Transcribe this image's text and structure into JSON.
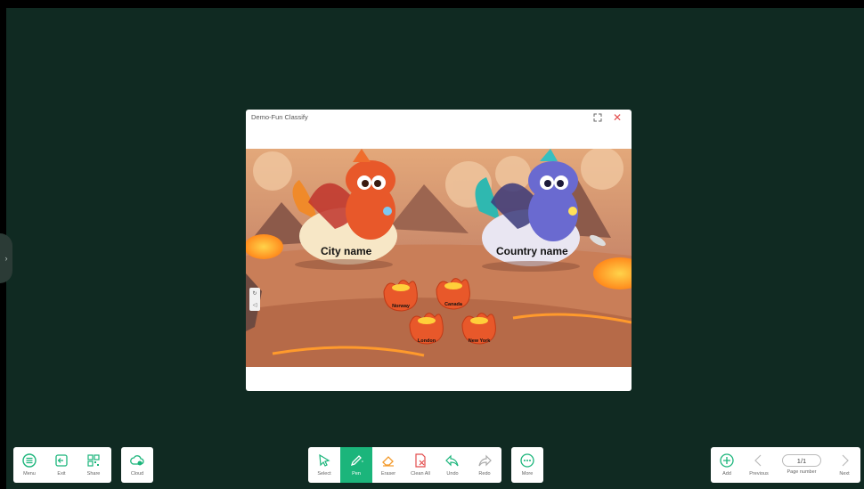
{
  "window": {
    "title": "Demo-Fun Classify",
    "labels": {
      "left_group": "City name",
      "right_group": "Country name"
    },
    "items": [
      "Norway",
      "Canada",
      "London",
      "New York"
    ]
  },
  "toolbar_left": {
    "menu": "Menu",
    "exit": "Exit",
    "share": "Share",
    "cloud": "Cloud"
  },
  "toolbar_center": {
    "select": "Select",
    "pen": "Pen",
    "eraser": "Eraser",
    "clean_all": "Clean All",
    "undo": "Undo",
    "redo": "Redo",
    "more": "More"
  },
  "toolbar_right": {
    "add": "Add",
    "previous": "Previous",
    "page_value": "1/1",
    "page_number": "Page number",
    "next": "Next"
  },
  "colors": {
    "board": "#102a22",
    "accent": "#1bb57b",
    "close": "#e34c4c"
  }
}
